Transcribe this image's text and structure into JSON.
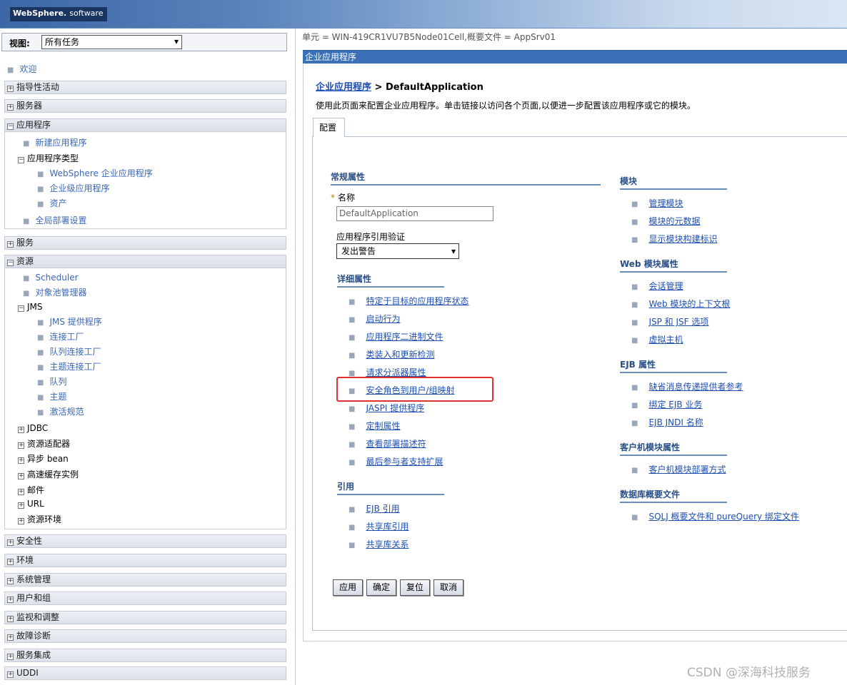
{
  "banner": {
    "brand": "WebSphere.",
    "brand_suffix": "software"
  },
  "nav": {
    "view_label": "视图:",
    "view_value": "所有任务",
    "welcome": "欢迎",
    "categories": {
      "guided": "指导性活动",
      "servers": "服务器",
      "applications": "应用程序",
      "services": "服务",
      "resources": "资源",
      "security": "安全性",
      "environment": "环境",
      "system_admin": "系统管理",
      "users_groups": "用户和组",
      "monitoring": "监视和调整",
      "troubleshooting": "故障诊断",
      "service_integration": "服务集成",
      "uddi": "UDDI"
    },
    "apps": {
      "new_app": "新建应用程序",
      "app_types": "应用程序类型",
      "websphere_apps": "WebSphere 企业应用程序",
      "business_apps": "企业级应用程序",
      "assets": "资产",
      "global_deploy": "全局部署设置"
    },
    "res": {
      "scheduler": "Scheduler",
      "pool_manager": "对象池管理器",
      "jms": "JMS",
      "jms_providers": "JMS 提供程序",
      "conn_factories": "连接工厂",
      "queue_conn_factories": "队列连接工厂",
      "topic_conn_factories": "主题连接工厂",
      "queues": "队列",
      "topics": "主题",
      "activation_specs": "激活规范",
      "jdbc": "JDBC",
      "adapters": "资源适配器",
      "async_beans": "异步 bean",
      "cache": "高速缓存实例",
      "mail": "邮件",
      "url": "URL",
      "res_env": "资源环境"
    }
  },
  "main": {
    "crumb": "单元 = WIN-419CR1VU7B5Node01Cell,概要文件 = AppSrv01",
    "header": "企业应用程序",
    "title_link": "企业应用程序",
    "title_sep": " > ",
    "title_current": "DefaultApplication",
    "description": "使用此页面来配置企业应用程序。单击链接以访问各个页面,以便进一步配置该应用程序或它的模块。",
    "tab": "配置",
    "general_title": "常规属性",
    "name_required": "*",
    "name_label": "名称",
    "name_value": "DefaultApplication",
    "auth_label": "应用程序引用验证",
    "auth_value": "发出警告",
    "detail_title": "详细属性",
    "detail_links": [
      "特定于目标的应用程序状态",
      "启动行为",
      "应用程序二进制文件",
      "类装入和更新检测",
      "请求分派器属性",
      "安全角色到用户/组映射",
      "JASPI 提供程序",
      "定制属性",
      "查看部署描述符",
      "最后参与者支持扩展"
    ],
    "ref_title": "引用",
    "ref_links": [
      "EJB 引用",
      "共享库引用",
      "共享库关系"
    ],
    "modules_title": "模块",
    "modules_links": [
      "管理模块",
      "模块的元数据",
      "显示模块构建标识"
    ],
    "web_title": "Web 模块属性",
    "web_links": [
      "会话管理",
      "Web 模块的上下文根",
      "JSP 和 JSF 选项",
      "虚拟主机"
    ],
    "ejb_title": "EJB 属性",
    "ejb_links": [
      "缺省消息传递提供者参考",
      "绑定 EJB 业务",
      "EJB JNDI 名称"
    ],
    "client_title": "客户机模块属性",
    "client_links": [
      "客户机模块部署方式"
    ],
    "db_title": "数据库概要文件",
    "db_links": [
      "SQLJ 概要文件和 pureQuery 绑定文件"
    ],
    "buttons": {
      "apply": "应用",
      "ok": "确定",
      "reset": "复位",
      "cancel": "取消"
    }
  },
  "watermark": "CSDN @深海科技服务"
}
